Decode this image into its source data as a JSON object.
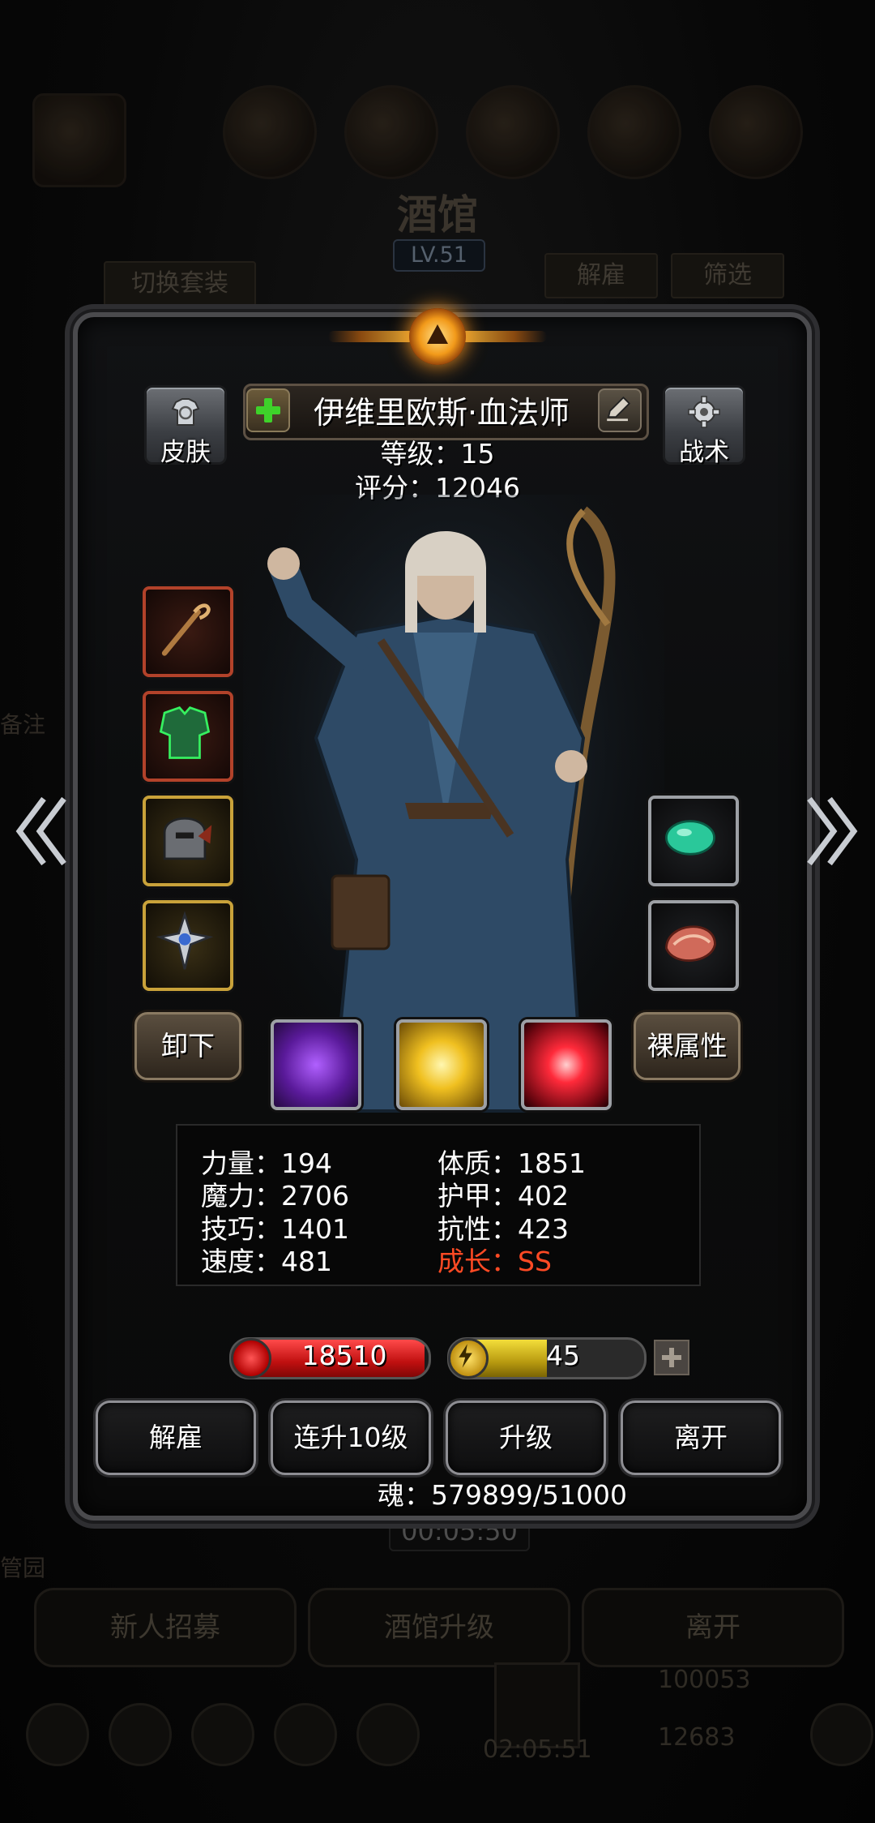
{
  "background": {
    "title": "酒馆",
    "level": "LV.51",
    "switch_outfit": "切换套装",
    "dismiss": "解雇",
    "filter": "筛选",
    "side_text_1": "备注",
    "side_text_2": "管园",
    "timer": "00:05:50",
    "bottom_buttons": [
      "新人招募",
      "酒馆升级",
      "离开"
    ],
    "gold": "100053",
    "footer_timer": "02:05:51",
    "gems": "12683"
  },
  "hero": {
    "name": "伊维里欧斯·血法师",
    "level_text": "等级：15",
    "score_text": "评分：12046",
    "skin_label": "皮肤",
    "tactics_label": "战术"
  },
  "equipment": {
    "unequip_label": "卸下",
    "raw_attr_label": "裸属性",
    "left_slots": [
      "staff-icon",
      "armor-icon",
      "helmet-icon",
      "amulet-icon"
    ],
    "right_slots": [
      "jade-gem-icon",
      "shell-trinket-icon"
    ],
    "skills": [
      "purple-boots-skill-icon",
      "yellow-burst-skill-icon",
      "red-slash-skill-icon"
    ]
  },
  "stats": {
    "strength": "力量：194",
    "magic": "魔力：2706",
    "skill": "技巧：1401",
    "speed": "速度：481",
    "constitution": "体质：1851",
    "armor": "护甲：402",
    "resistance": "抗性：423",
    "growth": "成长：SS"
  },
  "bars": {
    "hp": "18510",
    "hp_fill_fraction": 0.98,
    "energy": "45",
    "energy_fill_fraction": 0.5
  },
  "actions": {
    "dismiss": "解雇",
    "level_up_10": "连升10级",
    "level_up": "升级",
    "leave": "离开"
  },
  "soul_text": "魂：579899/51000",
  "colors": {
    "growth": "#ff4a24",
    "hp": "#c01010",
    "energy": "#d8bc20"
  }
}
